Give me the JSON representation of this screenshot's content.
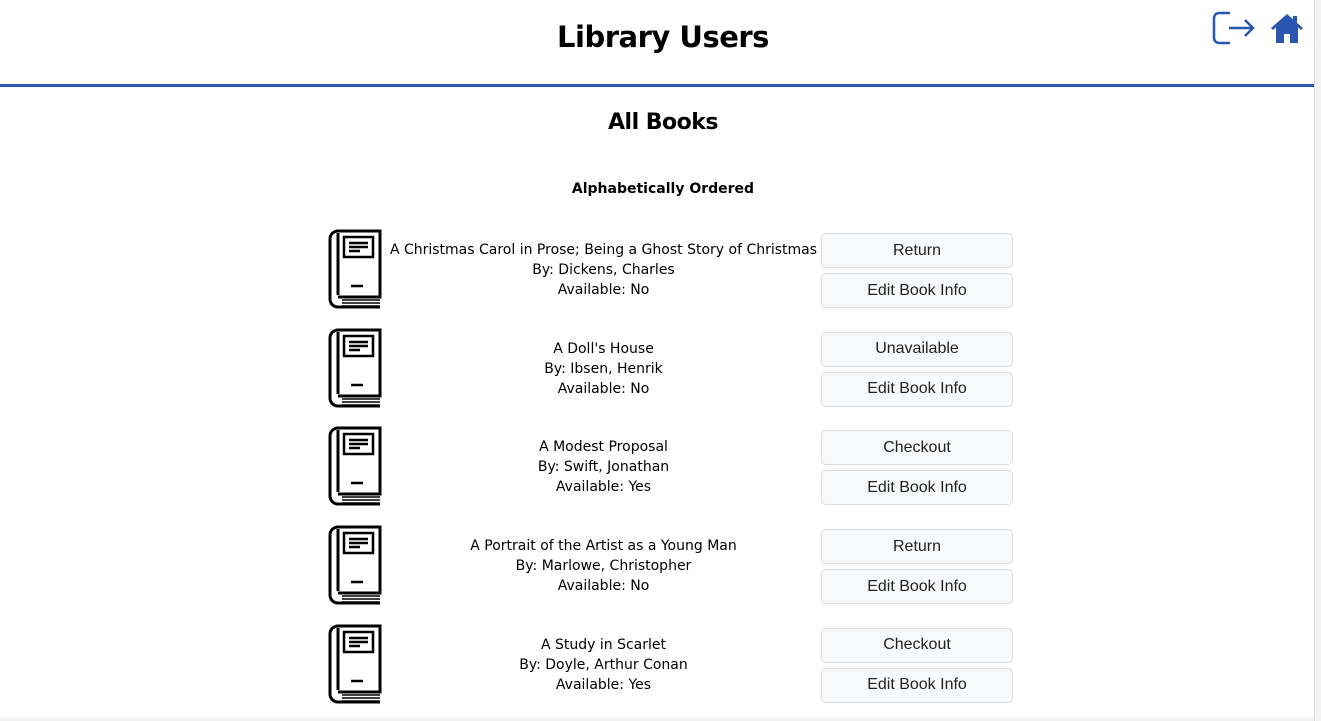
{
  "header": {
    "title": "Library Users",
    "logout_icon": "logout-icon",
    "home_icon": "home-icon",
    "accent": "#2a56b0"
  },
  "main": {
    "heading": "All Books",
    "subheading": "Alphabetically Ordered",
    "edit_label": "Edit Book Info",
    "books": [
      {
        "title": "A Christmas Carol in Prose; Being a Ghost Story of Christmas",
        "author": "By: Dickens, Charles",
        "available": "Available: No",
        "action": "Return"
      },
      {
        "title": "A Doll's House",
        "author": "By: Ibsen, Henrik",
        "available": "Available: No",
        "action": "Unavailable"
      },
      {
        "title": "A Modest Proposal",
        "author": "By: Swift, Jonathan",
        "available": "Available: Yes",
        "action": "Checkout"
      },
      {
        "title": "A Portrait of the Artist as a Young Man",
        "author": "By: Marlowe, Christopher",
        "available": "Available: No",
        "action": "Return"
      },
      {
        "title": "A Study in Scarlet",
        "author": "By: Doyle, Arthur Conan",
        "available": "Available: Yes",
        "action": "Checkout"
      }
    ]
  }
}
